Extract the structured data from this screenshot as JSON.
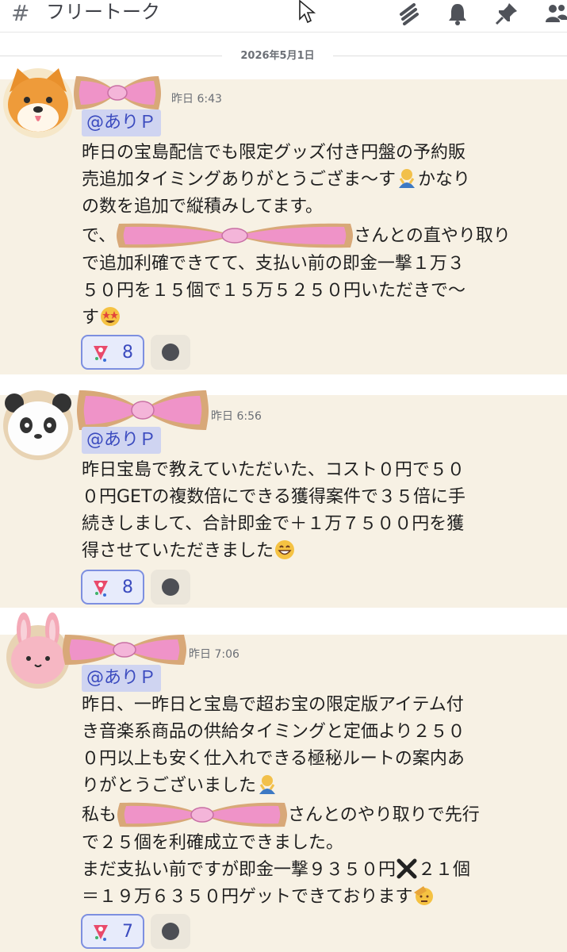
{
  "header": {
    "hash": "#",
    "channel_name": "フリートーク",
    "icons": [
      "threads-icon",
      "bell-icon",
      "pin-icon",
      "members-icon"
    ]
  },
  "date_divider": "2026年5月1日",
  "colors": {
    "message_bg": "#f7f1e4",
    "mention_bg": "#cfd4f1",
    "mention_text": "#3b4bbf",
    "reaction_border": "#7d8fe0",
    "ribbon_pink": "#ef93c8"
  },
  "messages": [
    {
      "avatar": "shiba-dog-avatar",
      "time": "昨日 6:43",
      "mention": "@ありＰ",
      "lines": [
        "昨日の宝島配信でも限定グッズ付き円盤の予約販",
        "売追加タイミングありがとうござま〜す",
        "かなり",
        "の数を追加で縦積みしてます。",
        "で、",
        "さんとの直やり取り",
        "で追加利確できてて、支払い前の即金一撃１万３",
        "５０円を１５個で１５万５２５０円いただきで〜",
        "す"
      ],
      "reaction_count": "8"
    },
    {
      "avatar": "panda-avatar",
      "time": "昨日 6:56",
      "mention": "@ありＰ",
      "lines": [
        "昨日宝島で教えていただいた、コスト０円で５０",
        "０円GETの複数倍にできる獲得案件で３５倍に手",
        "続きしまして、合計即金で＋１万７５００円を獲",
        "得させていただきました"
      ],
      "reaction_count": "8"
    },
    {
      "avatar": "rabbit-avatar",
      "time": "昨日 7:06",
      "mention": "@ありＰ",
      "lines": [
        "昨日、一昨日と宝島で超お宝の限定版アイテム付",
        "き音楽系商品の供給タイミングと定価より２５０",
        "０円以上も安く仕入れできる極秘ルートの案内あ",
        "りがとうございました",
        "私も",
        "さんとのやり取りで先行",
        "で２５個を利確成立できました。",
        "まだ支払い前ですが即金一撃９３５０円",
        "２１個",
        "＝１９万６３５０円ゲットできております"
      ],
      "reaction_count": "7"
    }
  ]
}
